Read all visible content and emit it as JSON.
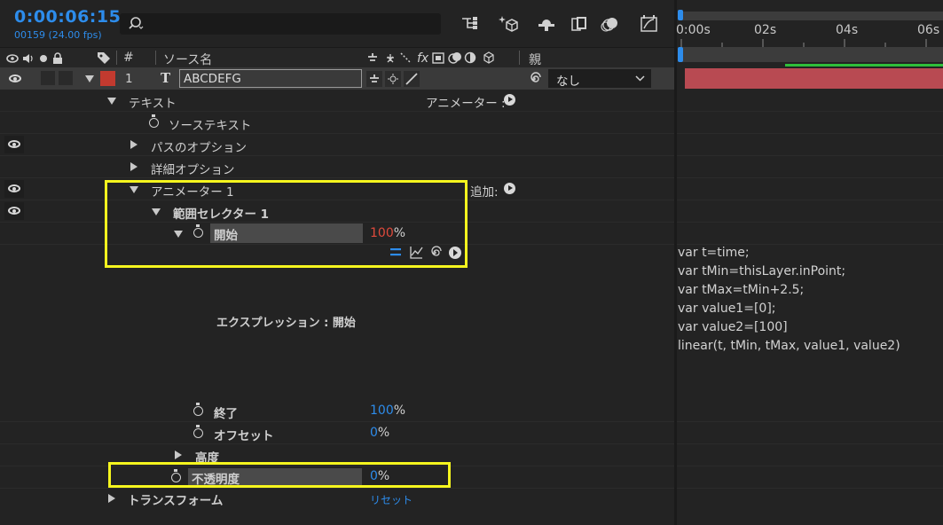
{
  "header": {
    "timecode": "0:00:06:15",
    "frame_info": "00159 (24.00 fps)",
    "search_icon": "search-icon"
  },
  "columns": {
    "number": "#",
    "source_name": "ソース名",
    "parent": "親"
  },
  "layer": {
    "number": "1",
    "type_glyph": "T",
    "name": "ABCDEFG",
    "parent_value": "なし",
    "label_color": "#c23a2f"
  },
  "tree": {
    "text_group": "テキスト",
    "animator_label": "アニメーター :",
    "source_text": "ソーステキスト",
    "path_options": "パスのオプション",
    "more_options": "詳細オプション",
    "animator1": "アニメーター 1",
    "add_label": "追加:",
    "range_selector": "範囲セレクター 1",
    "start": {
      "label": "開始",
      "value": "100",
      "unit": "%"
    },
    "expression_label": "エクスプレッション : 開始",
    "end": {
      "label": "終了",
      "value": "100",
      "unit": "%"
    },
    "offset": {
      "label": "オフセット",
      "value": "0",
      "unit": "%"
    },
    "advanced": "高度",
    "opacity": {
      "label": "不透明度",
      "value": "0",
      "unit": "%"
    },
    "transform": "トランスフォーム",
    "reset": "リセット"
  },
  "timeline": {
    "ruler": [
      "0:00s",
      "02s",
      "04s",
      "06s"
    ],
    "expression_lines": [
      "var t=time;",
      "var tMin=thisLayer.inPoint;",
      "var tMax=tMin+2.5;",
      "var value1=[0];",
      "var value2=[100]",
      "linear(t, tMin, tMax, value1, value2)"
    ],
    "layer_bar_color": "#b84a52"
  },
  "colors": {
    "accent_blue": "#2d8ceb",
    "highlight_yellow": "#f5f51e",
    "value_red": "#e04a3c"
  }
}
